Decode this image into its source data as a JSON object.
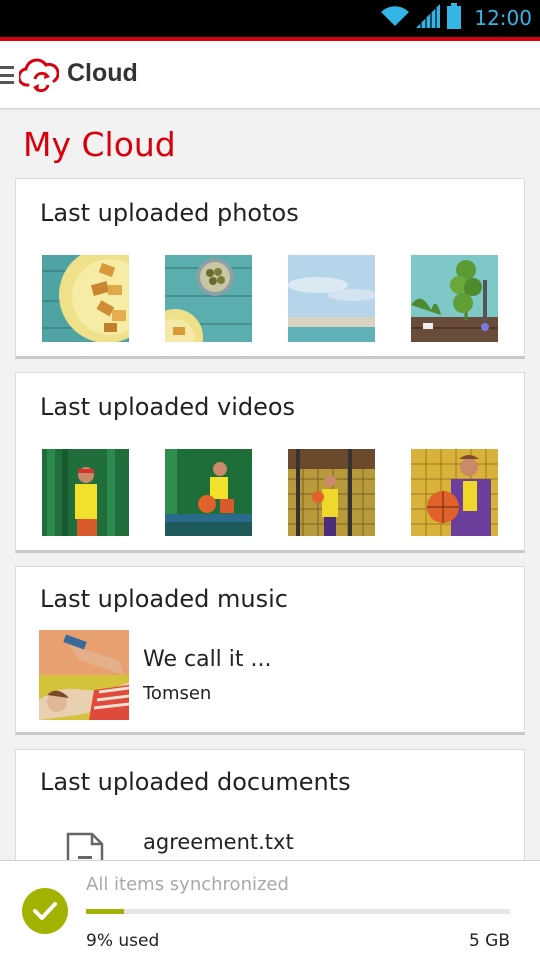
{
  "status_bar": {
    "time": "12:00",
    "icons": [
      "wifi-icon",
      "signal-icon",
      "battery-icon"
    ]
  },
  "app_bar": {
    "title": "Cloud",
    "icons": [
      "menu-icon",
      "cloud-sync-logo-icon"
    ]
  },
  "page_title": "My Cloud",
  "sections": {
    "photos": {
      "title": "Last uploaded photos",
      "items": [
        "photo-1",
        "photo-2",
        "photo-3",
        "photo-4"
      ]
    },
    "videos": {
      "title": "Last uploaded videos",
      "items": [
        "video-1",
        "video-2",
        "video-3",
        "video-4"
      ]
    },
    "music": {
      "title": "Last uploaded music",
      "track_title": "We call it ...",
      "artist": "Tomsen"
    },
    "documents": {
      "title": "Last uploaded documents",
      "file_name": "agreement.txt"
    }
  },
  "footer": {
    "sync_status": "All items synchronized",
    "usage_label": "9% used",
    "usage_fraction": 0.09,
    "quota": "5 GB"
  },
  "colors": {
    "brand_red": "#d9000d",
    "accent_green": "#a3b200",
    "status_blue": "#33b5e5"
  }
}
